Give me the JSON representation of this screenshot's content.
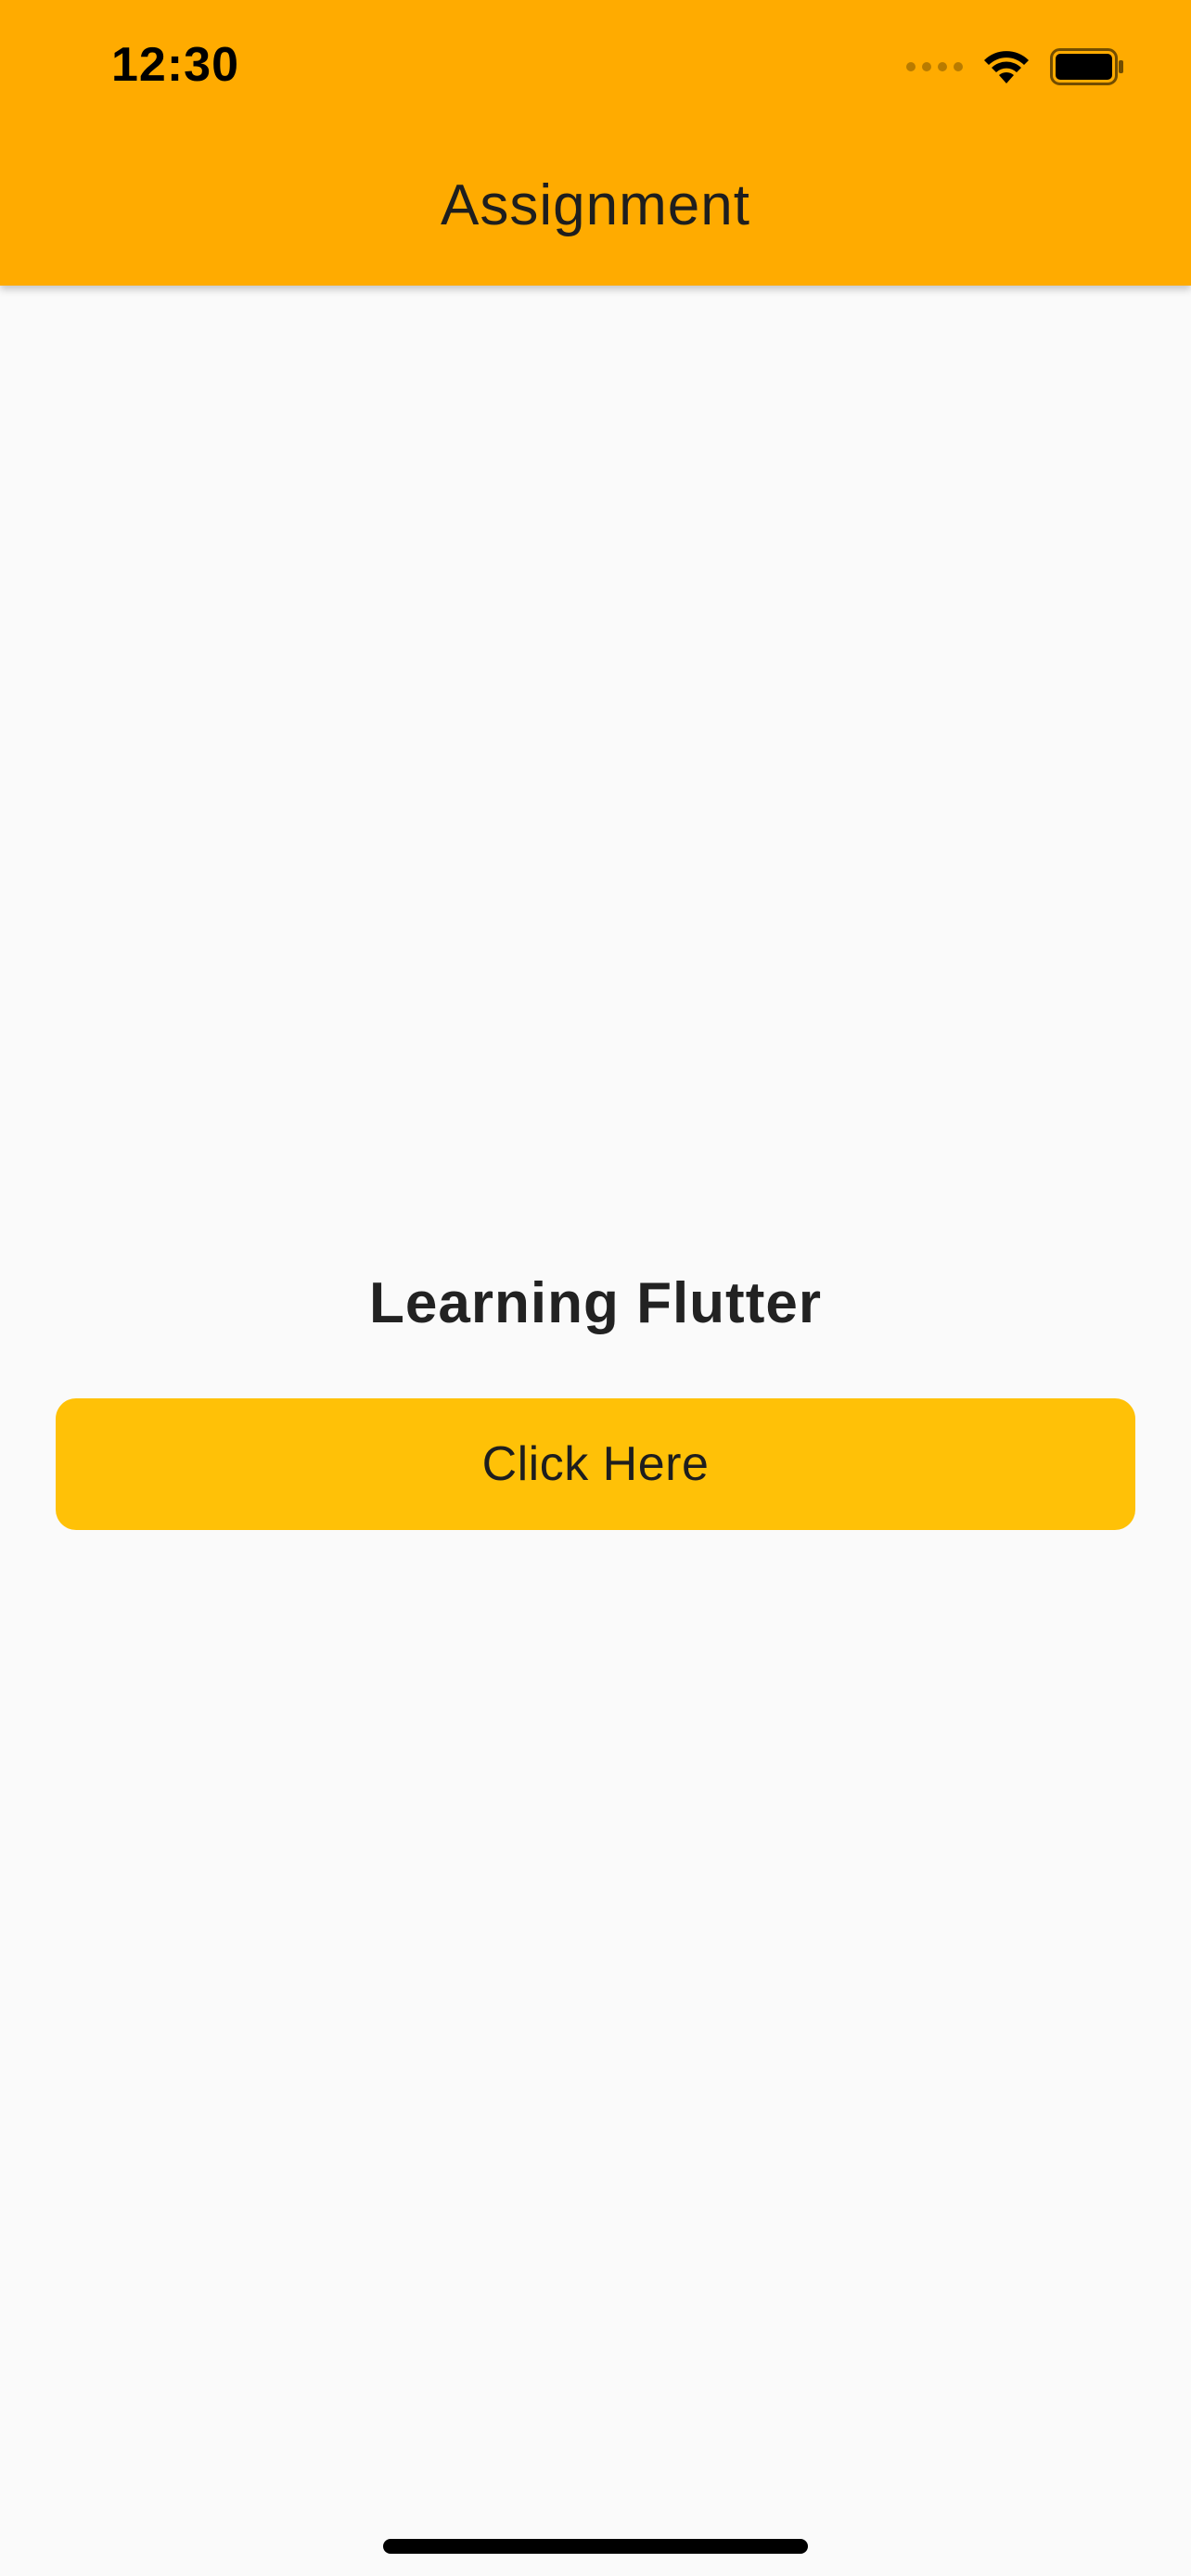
{
  "status_bar": {
    "time": "12:30",
    "icons": [
      "signal-icon",
      "wifi-icon",
      "battery-icon"
    ]
  },
  "app_bar": {
    "title": "Assignment",
    "color": "#FFAB00"
  },
  "main": {
    "headline": "Learning Flutter",
    "button_label": "Click Here",
    "button_color": "#FFC107"
  }
}
